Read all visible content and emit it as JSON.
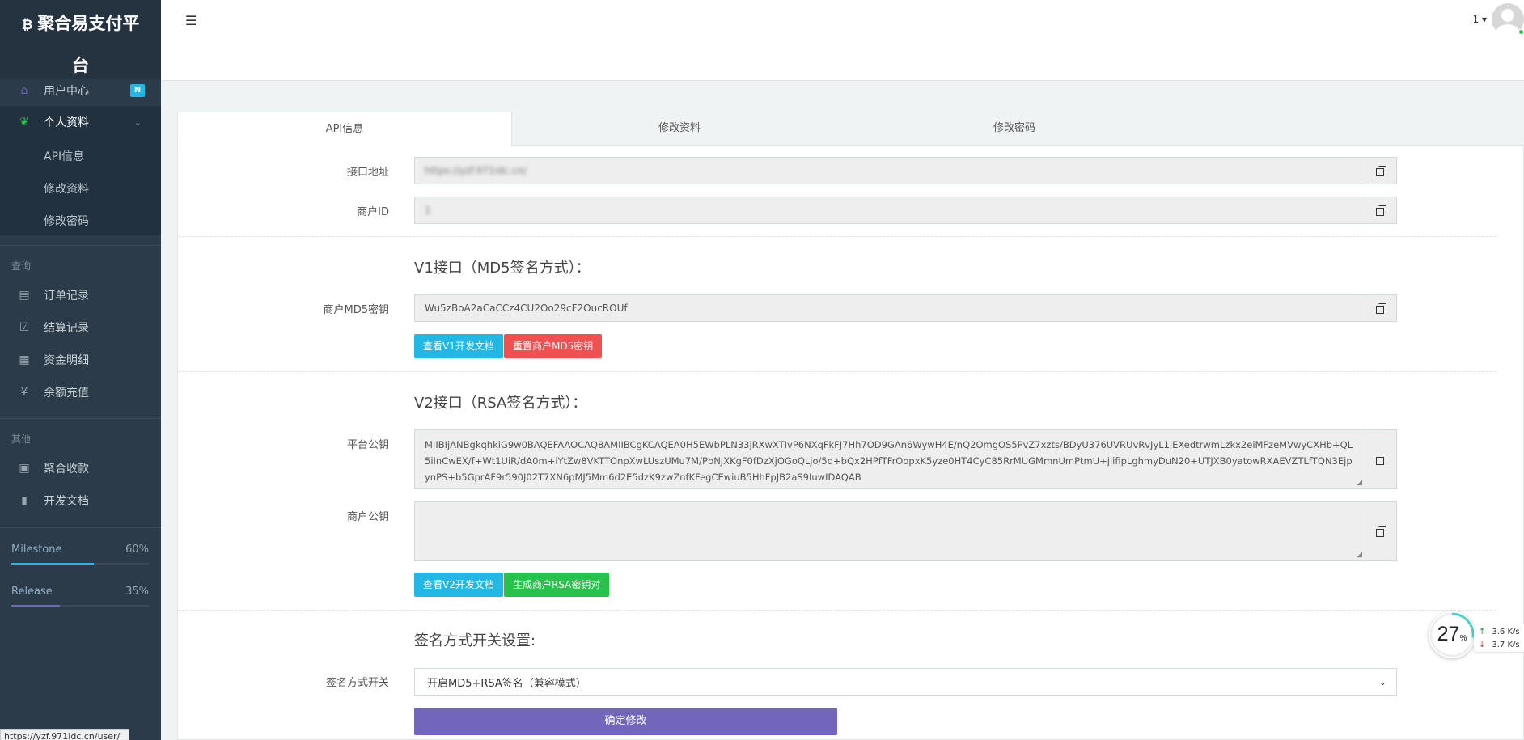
{
  "brand": {
    "logo_glyph": "₿",
    "title": "聚合易支付平台"
  },
  "sidebar": {
    "items": [
      {
        "label": "用户中心",
        "badge": "N",
        "icon": "home-icon"
      },
      {
        "label": "个人资料",
        "icon": "leaf-icon",
        "expanded": true
      }
    ],
    "subitems": [
      "API信息",
      "修改资料",
      "修改密码"
    ],
    "section_query": "查询",
    "query_items": [
      {
        "label": "订单记录",
        "icon": "list-icon"
      },
      {
        "label": "结算记录",
        "icon": "check-square-icon"
      },
      {
        "label": "资金明细",
        "icon": "calendar-icon"
      },
      {
        "label": "余额充值",
        "icon": "yen-icon"
      }
    ],
    "section_other": "其他",
    "other_items": [
      {
        "label": "聚合收款",
        "icon": "qrcode-icon"
      },
      {
        "label": "开发文档",
        "icon": "book-icon"
      }
    ],
    "progress": [
      {
        "label": "Milestone",
        "percent_text": "60%",
        "value": 0.6,
        "color": "#23b7e5"
      },
      {
        "label": "Release",
        "percent_text": "35%",
        "value": 0.35,
        "color": "#7266ba"
      }
    ]
  },
  "status_url": "https://yzf.971idc.cn/user/",
  "header": {
    "user_label": "1 ▾"
  },
  "tabs": [
    "API信息",
    "修改资料",
    "修改密码"
  ],
  "api": {
    "endpoint_label": "接口地址",
    "endpoint_value": "https://yzf.971idc.cn/",
    "merchant_id_label": "商户ID",
    "merchant_id_value": "1",
    "v1_title": "V1接口（MD5签名方式）：",
    "md5_label": "商户MD5密钥",
    "md5_value": "Wu5zBoA2aCaCCz4CU2Oo29cF2OucROUf",
    "btn_v1_doc": "查看V1开发文档",
    "btn_reset_md5": "重置商户MD5密钥",
    "v2_title": "V2接口（RSA签名方式）：",
    "platform_pubkey_label": "平台公钥",
    "platform_pubkey_value": "MIIBIjANBgkqhkiG9w0BAQEFAAOCAQ8AMIIBCgKCAQEA0H5EWbPLN33jRXwXTIvP6NXqFkFJ7Hh7OD9GAn6WywH4E/nQ2OmgOS5PvZ7xzts/BDyU376UVRUvRvJyL1iEXedtrwmLzkx2eiMFzeMVwyCXHb+QL5iInCwEX/f+Wt1UiR/dA0m+iYtZw8VKTTOnpXwLUszUMu7M/PbNJXKgF0fDzXjOGoQLjo/5d+bQx2HPfTFrOopxK5yze0HT4CyC85RrMUGMmnUmPtmU+jlifipLghmyDuN20+UTJXB0yatowRXAEVZTLfTQN3EjpynPS+b5GprAF9r590J02T7XN6pMJ5Mm6d2E5dzK9zwZnfKFegCEwiuB5HhFpJB2aS9IuwIDAQAB",
    "merchant_pubkey_label": "商户公钥",
    "merchant_pubkey_value": "",
    "btn_v2_doc": "查看V2开发文档",
    "btn_gen_rsa": "生成商户RSA密钥对",
    "sign_title": "签名方式开关设置:",
    "sign_label": "签名方式开关",
    "sign_selected": "开启MD5+RSA签名（兼容模式）",
    "submit": "确定修改"
  },
  "speed_widget": {
    "percent": "27",
    "unit": "%",
    "value": 0.27,
    "up": "3.6 K/s",
    "down": "3.7 K/s"
  }
}
